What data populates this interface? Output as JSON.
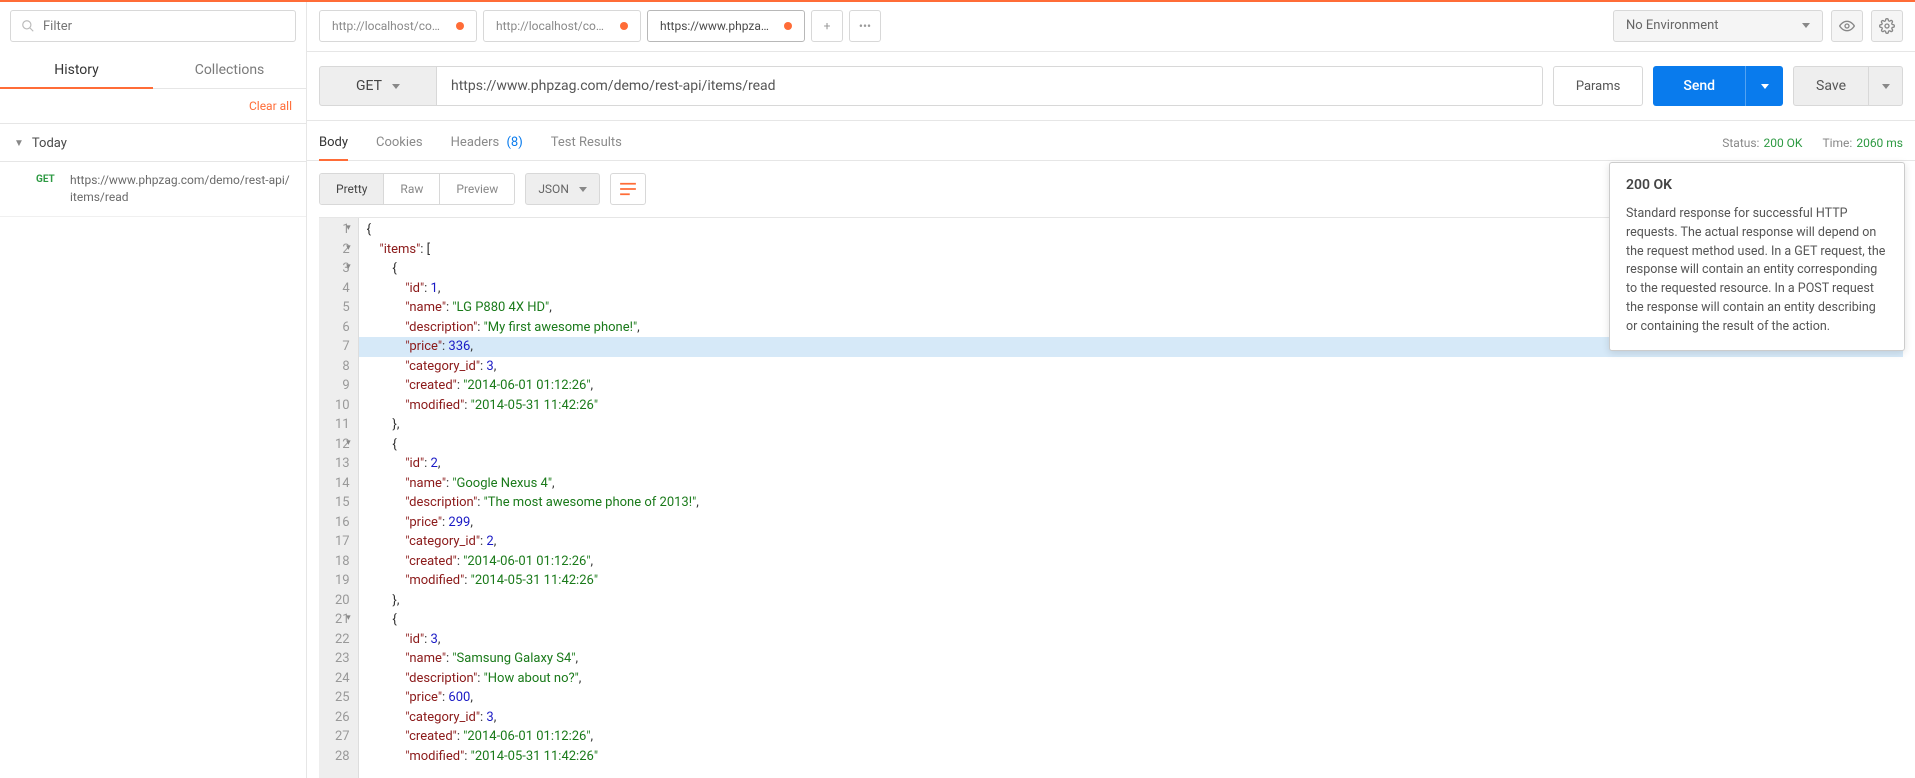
{
  "sidebar": {
    "filter_placeholder": "Filter",
    "tabs": {
      "history": "History",
      "collections": "Collections"
    },
    "clear_all": "Clear all",
    "group_title": "Today",
    "history_items": [
      {
        "method": "GET",
        "url": "https://www.phpzag.com/demo/rest-api/items/read"
      }
    ]
  },
  "tabs": [
    {
      "label": "http://localhost/coder",
      "dirty": true,
      "active": false
    },
    {
      "label": "http://localhost/coder",
      "dirty": true,
      "active": false
    },
    {
      "label": "https://www.phpzag.c",
      "dirty": true,
      "active": true
    }
  ],
  "env": {
    "label": "No Environment"
  },
  "request": {
    "method": "GET",
    "url": "https://www.phpzag.com/demo/rest-api/items/read",
    "params_btn": "Params",
    "send_btn": "Send",
    "save_btn": "Save"
  },
  "response_tabs": {
    "body": "Body",
    "cookies": "Cookies",
    "headers": "Headers",
    "headers_count": "(8)",
    "test_results": "Test Results"
  },
  "response_meta": {
    "status_label": "Status:",
    "status_value": "200 OK",
    "time_label": "Time:",
    "time_value": "2060 ms"
  },
  "resp_toolbar": {
    "pretty": "Pretty",
    "raw": "Raw",
    "preview": "Preview",
    "format": "JSON"
  },
  "tooltip": {
    "title": "200 OK",
    "body": "Standard response for successful HTTP requests. The actual response will depend on the request method used. In a GET request, the response will contain an entity corresponding to the requested resource. In a POST request the response will contain an entity describing or containing the result of the action."
  },
  "code_lines": [
    {
      "n": 1,
      "fold": true,
      "indent": 0,
      "parts": [
        {
          "t": "punc",
          "v": "{"
        }
      ]
    },
    {
      "n": 2,
      "fold": true,
      "indent": 1,
      "parts": [
        {
          "t": "key",
          "v": "\"items\""
        },
        {
          "t": "punc",
          "v": ": ["
        }
      ]
    },
    {
      "n": 3,
      "fold": true,
      "indent": 2,
      "parts": [
        {
          "t": "punc",
          "v": "{"
        }
      ]
    },
    {
      "n": 4,
      "indent": 3,
      "parts": [
        {
          "t": "key",
          "v": "\"id\""
        },
        {
          "t": "punc",
          "v": ": "
        },
        {
          "t": "num",
          "v": "1"
        },
        {
          "t": "punc",
          "v": ","
        }
      ]
    },
    {
      "n": 5,
      "indent": 3,
      "parts": [
        {
          "t": "key",
          "v": "\"name\""
        },
        {
          "t": "punc",
          "v": ": "
        },
        {
          "t": "str",
          "v": "\"LG P880 4X HD\""
        },
        {
          "t": "punc",
          "v": ","
        }
      ]
    },
    {
      "n": 6,
      "indent": 3,
      "parts": [
        {
          "t": "key",
          "v": "\"description\""
        },
        {
          "t": "punc",
          "v": ": "
        },
        {
          "t": "str",
          "v": "\"My first awesome phone!\""
        },
        {
          "t": "punc",
          "v": ","
        }
      ]
    },
    {
      "n": 7,
      "hl": true,
      "indent": 3,
      "parts": [
        {
          "t": "key",
          "v": "\"price\""
        },
        {
          "t": "punc",
          "v": ": "
        },
        {
          "t": "num",
          "v": "336"
        },
        {
          "t": "punc",
          "v": ","
        }
      ]
    },
    {
      "n": 8,
      "indent": 3,
      "parts": [
        {
          "t": "key",
          "v": "\"category_id\""
        },
        {
          "t": "punc",
          "v": ": "
        },
        {
          "t": "num",
          "v": "3"
        },
        {
          "t": "punc",
          "v": ","
        }
      ]
    },
    {
      "n": 9,
      "indent": 3,
      "parts": [
        {
          "t": "key",
          "v": "\"created\""
        },
        {
          "t": "punc",
          "v": ": "
        },
        {
          "t": "str",
          "v": "\"2014-06-01 01:12:26\""
        },
        {
          "t": "punc",
          "v": ","
        }
      ]
    },
    {
      "n": 10,
      "indent": 3,
      "parts": [
        {
          "t": "key",
          "v": "\"modified\""
        },
        {
          "t": "punc",
          "v": ": "
        },
        {
          "t": "str",
          "v": "\"2014-05-31 11:42:26\""
        }
      ]
    },
    {
      "n": 11,
      "indent": 2,
      "parts": [
        {
          "t": "punc",
          "v": "},"
        }
      ]
    },
    {
      "n": 12,
      "fold": true,
      "indent": 2,
      "parts": [
        {
          "t": "punc",
          "v": "{"
        }
      ]
    },
    {
      "n": 13,
      "indent": 3,
      "parts": [
        {
          "t": "key",
          "v": "\"id\""
        },
        {
          "t": "punc",
          "v": ": "
        },
        {
          "t": "num",
          "v": "2"
        },
        {
          "t": "punc",
          "v": ","
        }
      ]
    },
    {
      "n": 14,
      "indent": 3,
      "parts": [
        {
          "t": "key",
          "v": "\"name\""
        },
        {
          "t": "punc",
          "v": ": "
        },
        {
          "t": "str",
          "v": "\"Google Nexus 4\""
        },
        {
          "t": "punc",
          "v": ","
        }
      ]
    },
    {
      "n": 15,
      "indent": 3,
      "parts": [
        {
          "t": "key",
          "v": "\"description\""
        },
        {
          "t": "punc",
          "v": ": "
        },
        {
          "t": "str",
          "v": "\"The most awesome phone of 2013!\""
        },
        {
          "t": "punc",
          "v": ","
        }
      ]
    },
    {
      "n": 16,
      "indent": 3,
      "parts": [
        {
          "t": "key",
          "v": "\"price\""
        },
        {
          "t": "punc",
          "v": ": "
        },
        {
          "t": "num",
          "v": "299"
        },
        {
          "t": "punc",
          "v": ","
        }
      ]
    },
    {
      "n": 17,
      "indent": 3,
      "parts": [
        {
          "t": "key",
          "v": "\"category_id\""
        },
        {
          "t": "punc",
          "v": ": "
        },
        {
          "t": "num",
          "v": "2"
        },
        {
          "t": "punc",
          "v": ","
        }
      ]
    },
    {
      "n": 18,
      "indent": 3,
      "parts": [
        {
          "t": "key",
          "v": "\"created\""
        },
        {
          "t": "punc",
          "v": ": "
        },
        {
          "t": "str",
          "v": "\"2014-06-01 01:12:26\""
        },
        {
          "t": "punc",
          "v": ","
        }
      ]
    },
    {
      "n": 19,
      "indent": 3,
      "parts": [
        {
          "t": "key",
          "v": "\"modified\""
        },
        {
          "t": "punc",
          "v": ": "
        },
        {
          "t": "str",
          "v": "\"2014-05-31 11:42:26\""
        }
      ]
    },
    {
      "n": 20,
      "indent": 2,
      "parts": [
        {
          "t": "punc",
          "v": "},"
        }
      ]
    },
    {
      "n": 21,
      "fold": true,
      "indent": 2,
      "parts": [
        {
          "t": "punc",
          "v": "{"
        }
      ]
    },
    {
      "n": 22,
      "indent": 3,
      "parts": [
        {
          "t": "key",
          "v": "\"id\""
        },
        {
          "t": "punc",
          "v": ": "
        },
        {
          "t": "num",
          "v": "3"
        },
        {
          "t": "punc",
          "v": ","
        }
      ]
    },
    {
      "n": 23,
      "indent": 3,
      "parts": [
        {
          "t": "key",
          "v": "\"name\""
        },
        {
          "t": "punc",
          "v": ": "
        },
        {
          "t": "str",
          "v": "\"Samsung Galaxy S4\""
        },
        {
          "t": "punc",
          "v": ","
        }
      ]
    },
    {
      "n": 24,
      "indent": 3,
      "parts": [
        {
          "t": "key",
          "v": "\"description\""
        },
        {
          "t": "punc",
          "v": ": "
        },
        {
          "t": "str",
          "v": "\"How about no?\""
        },
        {
          "t": "punc",
          "v": ","
        }
      ]
    },
    {
      "n": 25,
      "indent": 3,
      "parts": [
        {
          "t": "key",
          "v": "\"price\""
        },
        {
          "t": "punc",
          "v": ": "
        },
        {
          "t": "num",
          "v": "600"
        },
        {
          "t": "punc",
          "v": ","
        }
      ]
    },
    {
      "n": 26,
      "indent": 3,
      "parts": [
        {
          "t": "key",
          "v": "\"category_id\""
        },
        {
          "t": "punc",
          "v": ": "
        },
        {
          "t": "num",
          "v": "3"
        },
        {
          "t": "punc",
          "v": ","
        }
      ]
    },
    {
      "n": 27,
      "indent": 3,
      "parts": [
        {
          "t": "key",
          "v": "\"created\""
        },
        {
          "t": "punc",
          "v": ": "
        },
        {
          "t": "str",
          "v": "\"2014-06-01 01:12:26\""
        },
        {
          "t": "punc",
          "v": ","
        }
      ]
    },
    {
      "n": 28,
      "indent": 3,
      "parts": [
        {
          "t": "key",
          "v": "\"modified\""
        },
        {
          "t": "punc",
          "v": ": "
        },
        {
          "t": "str",
          "v": "\"2014-05-31 11:42:26\""
        }
      ]
    }
  ]
}
